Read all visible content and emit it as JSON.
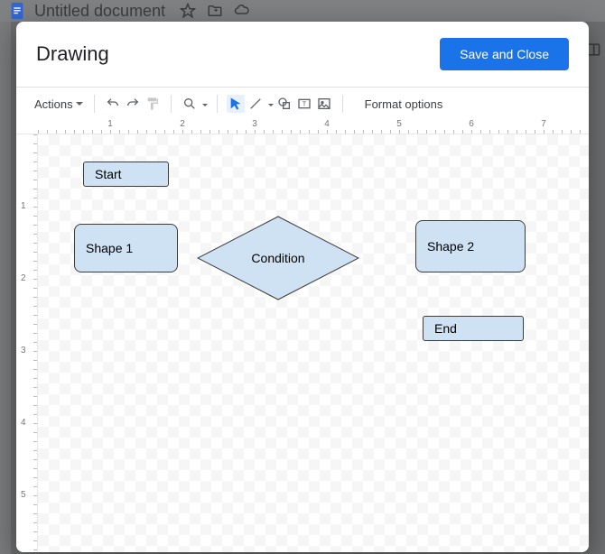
{
  "background": {
    "doc_title": "Untitled document"
  },
  "modal": {
    "title": "Drawing",
    "save_label": "Save and Close"
  },
  "toolbar": {
    "actions_label": "Actions",
    "format_options_label": "Format options"
  },
  "ruler": {
    "h": [
      "1",
      "2",
      "3",
      "4",
      "5",
      "6",
      "7"
    ],
    "v": [
      "1",
      "2",
      "3",
      "4",
      "5"
    ]
  },
  "shapes": {
    "start": {
      "label": "Start"
    },
    "shape1": {
      "label": "Shape 1"
    },
    "condition": {
      "label": "Condition"
    },
    "shape2": {
      "label": "Shape 2"
    },
    "end": {
      "label": "End"
    }
  },
  "colors": {
    "shape_fill": "#cfe2f3",
    "shape_stroke": "#3c3c3c",
    "primary_button": "#1a73e8"
  }
}
